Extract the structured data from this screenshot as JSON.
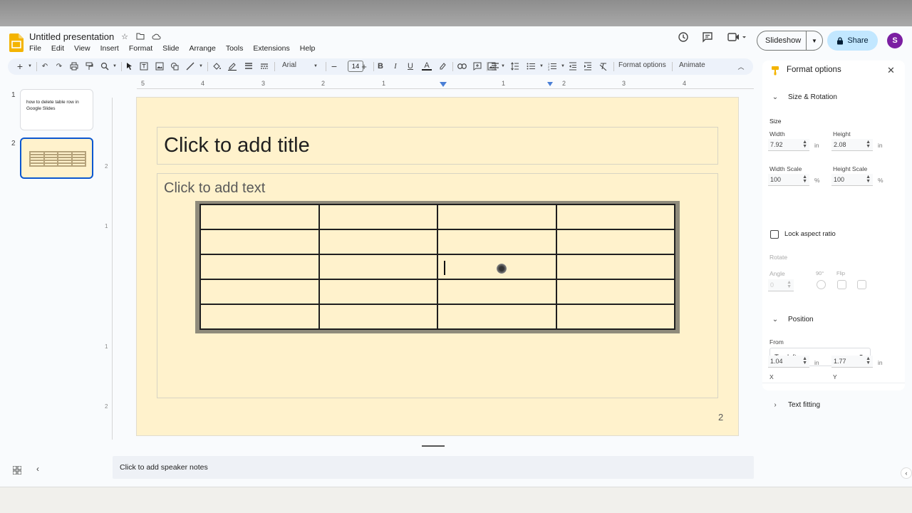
{
  "header": {
    "doc_title": "Untitled presentation",
    "menu": [
      "File",
      "Edit",
      "View",
      "Insert",
      "Format",
      "Slide",
      "Arrange",
      "Tools",
      "Extensions",
      "Help"
    ],
    "slideshow_label": "Slideshow",
    "share_label": "Share",
    "avatar_initial": "S"
  },
  "toolbar": {
    "font_name": "Arial",
    "font_size": "14",
    "format_options_label": "Format options",
    "animate_label": "Animate"
  },
  "filmstrip": {
    "slides": [
      {
        "number": "1",
        "text": "how to delete table row in Google Slides"
      },
      {
        "number": "2",
        "text": ""
      }
    ]
  },
  "ruler": {
    "h_labels": [
      "5",
      "4",
      "3",
      "2",
      "1",
      "1",
      "2",
      "3",
      "4"
    ],
    "v_labels": [
      "2",
      "1",
      "1",
      "2"
    ]
  },
  "slide": {
    "title_placeholder": "Click to add title",
    "body_placeholder": "Click to add text",
    "slide_number": "2",
    "table": {
      "rows": 5,
      "cols": 4
    }
  },
  "notes": {
    "placeholder": "Click to add speaker notes"
  },
  "format_panel": {
    "title": "Format options",
    "size_rotation": {
      "heading": "Size & Rotation",
      "size_label": "Size",
      "width_label": "Width",
      "width_value": "7.92",
      "height_label": "Height",
      "height_value": "2.08",
      "unit_in": "in",
      "width_scale_label": "Width Scale",
      "width_scale_value": "100",
      "height_scale_label": "Height Scale",
      "height_scale_value": "100",
      "unit_pct": "%",
      "lock_label": "Lock aspect ratio",
      "rotate_label": "Rotate",
      "angle_label": "Angle",
      "angle_value": "0",
      "deg_90_label": "90°",
      "flip_label": "Flip"
    },
    "position": {
      "heading": "Position",
      "from_label": "From",
      "from_value": "Top left",
      "x_label": "X",
      "x_value": "1.04",
      "y_label": "Y",
      "y_value": "1.77",
      "unit_in": "in"
    },
    "text_fitting": {
      "heading": "Text fitting"
    }
  },
  "colors": {
    "accent": "#0b57d0",
    "share_bg": "#c2e7ff",
    "slide_bg": "#fff2cc",
    "avatar": "#7b1fa2",
    "logo": "#f4b400"
  }
}
